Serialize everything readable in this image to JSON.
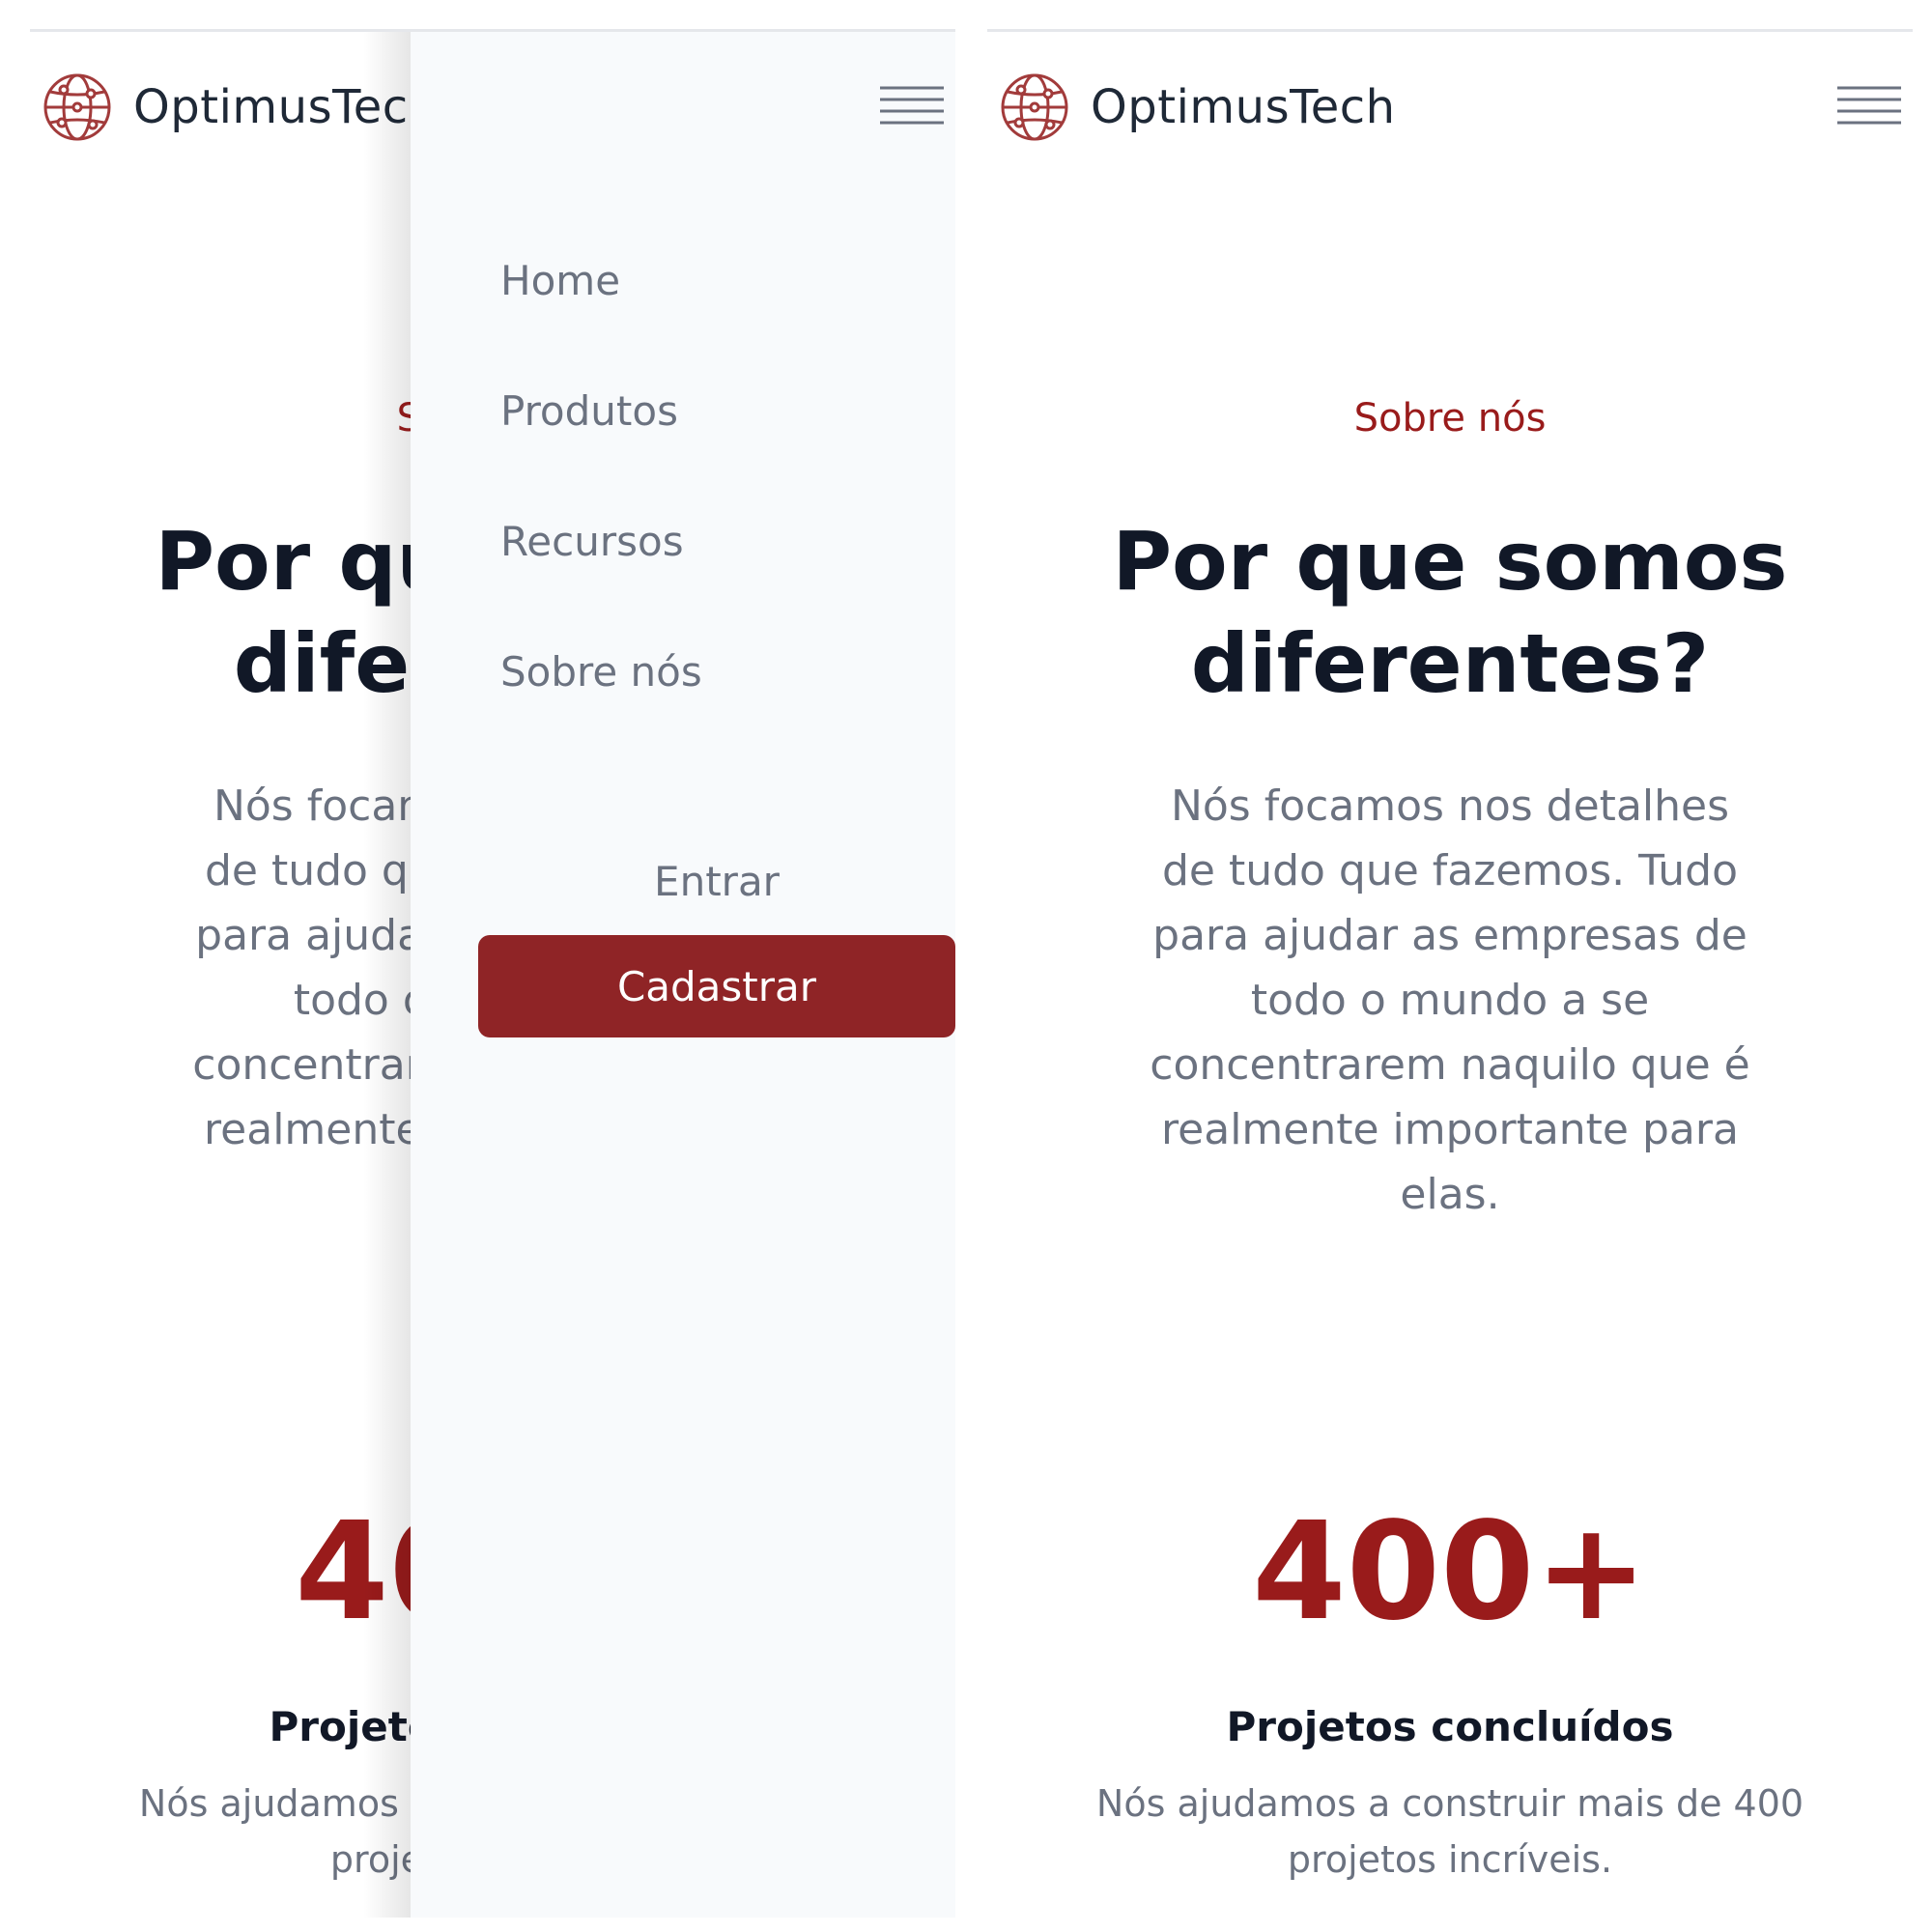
{
  "brand": {
    "name": "OptimusTech",
    "logo_icon": "globe-network-icon",
    "accent_color": "#991b1b"
  },
  "header": {
    "menu_icon": "hamburger-menu-icon"
  },
  "about": {
    "eyebrow": "Sobre nós",
    "heading_line1": "Por que somos",
    "heading_line2": "diferentes?",
    "description_lines": [
      "Nós focamos nos detalhes",
      "de tudo que fazemos. Tudo",
      "para ajudar as empresas de",
      "todo o mundo a se",
      "concentrarem naquilo que é",
      "realmente importante para",
      "elas."
    ]
  },
  "stats": {
    "value": "400+",
    "label": "Projetos concluídos",
    "desc_line1": "Nós ajudamos a construir mais de 400",
    "desc_line2": "projetos incríveis."
  },
  "drawer": {
    "nav_items": [
      "Home",
      "Produtos",
      "Recursos",
      "Sobre nós"
    ],
    "login_label": "Entrar",
    "signup_label": "Cadastrar",
    "background": "#f8fafc",
    "button_color": "#8f2426"
  }
}
